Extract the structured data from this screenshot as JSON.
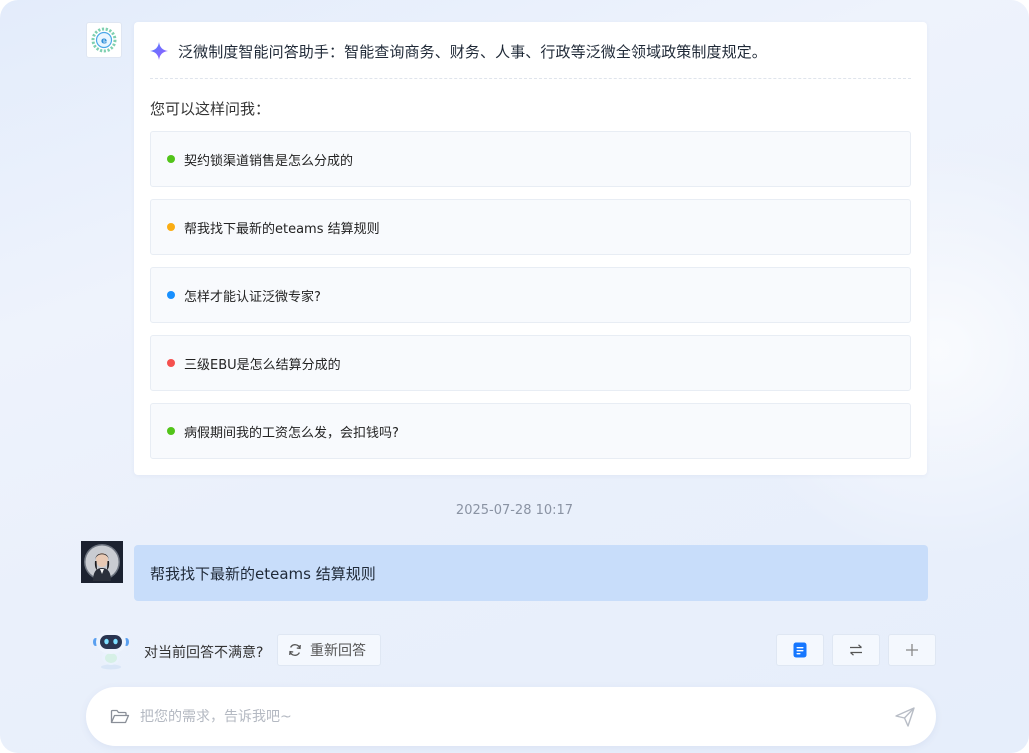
{
  "answer_card": {
    "title": "泛微制度智能问答助手：智能查询商务、财务、人事、行政等泛微全领域政策制度规定。",
    "subtitle": "您可以这样问我：",
    "suggestions": [
      {
        "text": "契约锁渠道销售是怎么分成的",
        "color": "#52c41a"
      },
      {
        "text": "帮我找下最新的eteams 结算规则",
        "color": "#faad14"
      },
      {
        "text": "怎样才能认证泛微专家?",
        "color": "#1890ff"
      },
      {
        "text": "三级EBU是怎么结算分成的",
        "color": "#f5504e"
      },
      {
        "text": "病假期间我的工资怎么发，会扣钱吗?",
        "color": "#52c41a"
      }
    ]
  },
  "timestamp": "2025-07-28 10:17",
  "user_message": "帮我找下最新的eteams 结算规则",
  "feedback": {
    "prompt": "对当前回答不满意?",
    "regenerate_label": "重新回答"
  },
  "toolbar": {
    "icons": [
      "document-icon",
      "switch-icon",
      "plus-icon"
    ],
    "accent": "#1677ff"
  },
  "input": {
    "placeholder": "把您的需求，告诉我吧~",
    "value": ""
  }
}
